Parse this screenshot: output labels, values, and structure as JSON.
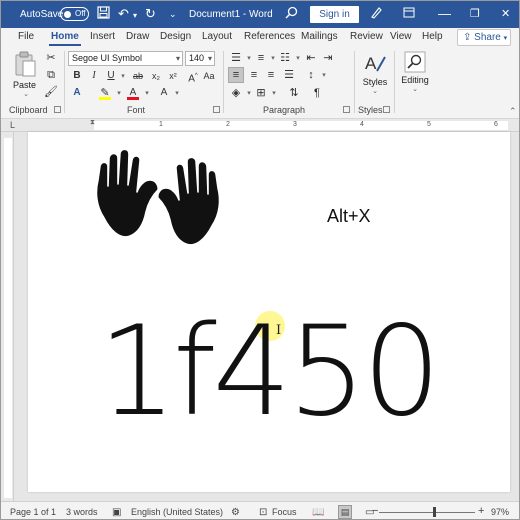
{
  "titlebar": {
    "autosave_label": "AutoSave",
    "autosave_state": "Off",
    "document_title": "Document1 - Word",
    "signin_label": "Sign in",
    "minimize_glyph": "—",
    "restore_glyph": "❐",
    "close_glyph": "✕"
  },
  "tabs": [
    "File",
    "Home",
    "Insert",
    "Draw",
    "Design",
    "Layout",
    "References",
    "Mailings",
    "Review",
    "View",
    "Help"
  ],
  "share_label": "Share",
  "ribbon": {
    "clipboard": {
      "paste_label": "Paste",
      "group_label": "Clipboard"
    },
    "font": {
      "font_name": "Segoe UI Symbol",
      "font_size": "140",
      "group_label": "Font",
      "buttons": [
        "B",
        "I",
        "U",
        "ab",
        "x₂",
        "x²",
        "A",
        "Aa",
        "A",
        "A"
      ]
    },
    "paragraph": {
      "group_label": "Paragraph"
    },
    "styles": {
      "label": "Styles",
      "group_label": "Styles"
    },
    "editing": {
      "label": "Editing"
    },
    "highlight_color": "#ffff00",
    "font_color": "#e81123"
  },
  "ruler": {
    "numbers": [
      "1",
      "2",
      "3",
      "4",
      "5",
      "6"
    ]
  },
  "document": {
    "emoji": "🙌",
    "hotkey_text": "Alt+X",
    "code_text": "1f450"
  },
  "status": {
    "page": "Page 1 of 1",
    "words": "3 words",
    "language": "English (United States)",
    "focus": "Focus",
    "zoom_minus": "−",
    "zoom_plus": "+",
    "zoom": "97%"
  },
  "colors": {
    "accent": "#2b579a",
    "cursor_highlight": "#ffee3c"
  }
}
